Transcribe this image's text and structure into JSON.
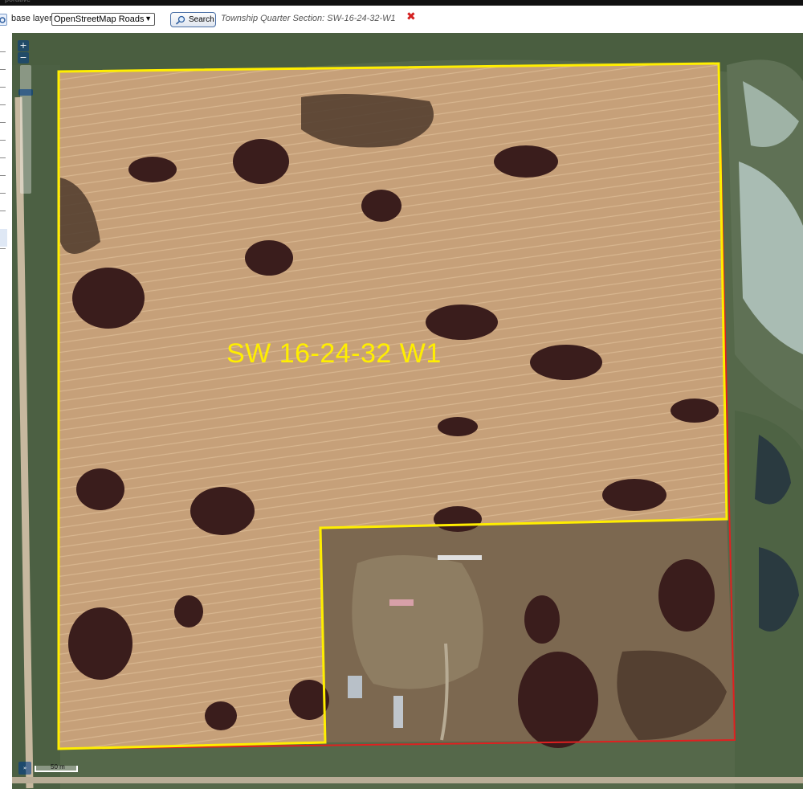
{
  "top_strip_text": "porative",
  "toolbar": {
    "base_layer_label": "base layer:",
    "base_layer_value": "OpenStreetMap Roads",
    "search_label": "Search",
    "township_section": "Township Quarter Section: SW-16-24-32-W1",
    "clear_label": "✖"
  },
  "map": {
    "zoom_in": "+",
    "zoom_out": "−",
    "parcel_label": "SW 16-24-32 W1",
    "scale_label": "50 m",
    "parcel_outline_color": "#ffee00",
    "boundary_color": "#e02020"
  }
}
